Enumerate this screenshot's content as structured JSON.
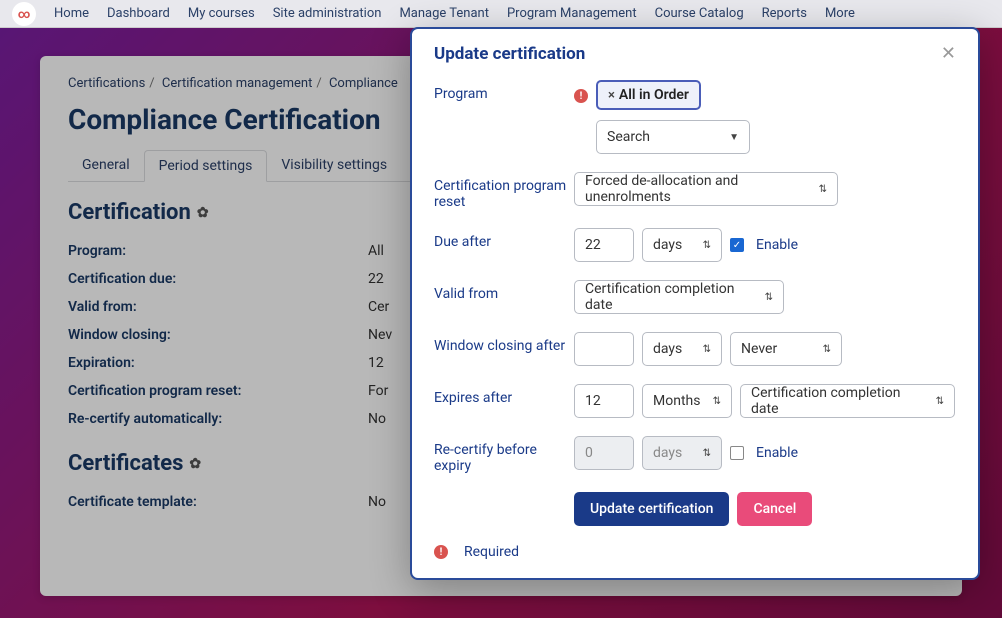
{
  "nav": [
    "Home",
    "Dashboard",
    "My courses",
    "Site administration",
    "Manage Tenant",
    "Program Management",
    "Course Catalog",
    "Reports",
    "More"
  ],
  "breadcrumbs": [
    "Certifications",
    "Certification management",
    "Compliance"
  ],
  "page_title": "Compliance Certification",
  "tabs": [
    "General",
    "Period settings",
    "Visibility settings"
  ],
  "section1": "Certification",
  "kv": [
    {
      "k": "Program:",
      "v": "All"
    },
    {
      "k": "Certification due:",
      "v": "22"
    },
    {
      "k": "Valid from:",
      "v": "Cer"
    },
    {
      "k": "Window closing:",
      "v": "Nev"
    },
    {
      "k": "Expiration:",
      "v": "12"
    },
    {
      "k": "Certification program reset:",
      "v": "For"
    },
    {
      "k": "Re-certify automatically:",
      "v": "No"
    }
  ],
  "section2": "Certificates",
  "kv2": [
    {
      "k": "Certificate template:",
      "v": "No"
    }
  ],
  "modal": {
    "title": "Update certification",
    "program_label": "Program",
    "program_pill": "All in Order",
    "search_placeholder": "Search",
    "reset_label": "Certification program reset",
    "reset_value": "Forced de-allocation and unenrolments",
    "due_label": "Due after",
    "due_num": "22",
    "due_unit": "days",
    "enable": "Enable",
    "valid_label": "Valid from",
    "valid_value": "Certification completion date",
    "window_label": "Window closing after",
    "window_num": "",
    "window_unit": "days",
    "window_mode": "Never",
    "expires_label": "Expires after",
    "expires_num": "12",
    "expires_unit": "Months",
    "expires_from": "Certification completion date",
    "recert_label": "Re-certify before expiry",
    "recert_num": "0",
    "recert_unit": "days",
    "submit": "Update certification",
    "cancel": "Cancel",
    "required": "Required"
  }
}
